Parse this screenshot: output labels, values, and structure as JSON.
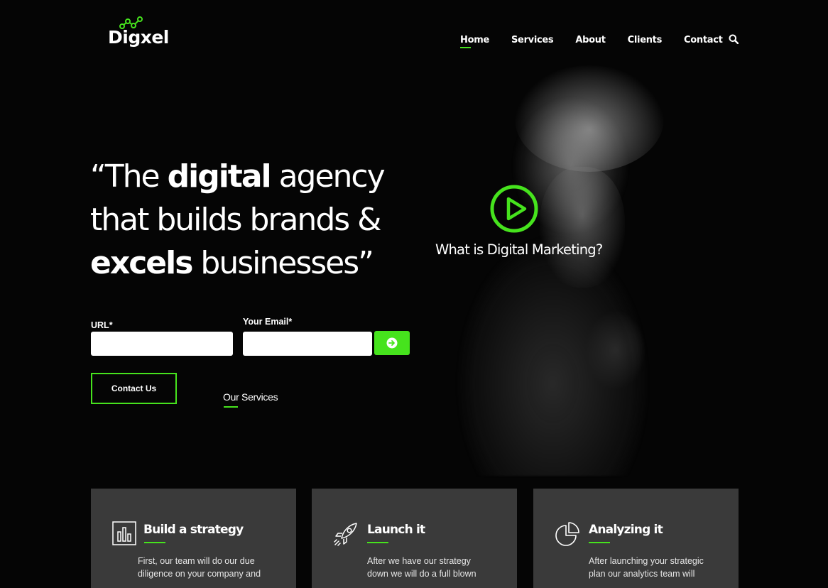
{
  "brand": {
    "name": "Digxel",
    "accent": "#46e31d"
  },
  "nav": {
    "items": [
      {
        "label": "Home",
        "active": true
      },
      {
        "label": "Services"
      },
      {
        "label": "About"
      },
      {
        "label": "Clients"
      },
      {
        "label": "Contact"
      }
    ],
    "search_icon": "search-icon"
  },
  "hero": {
    "line1_pre": "“The ",
    "line1_bold": "digital",
    "line1_post": " agency",
    "line2": "that builds brands &",
    "line3_bold": "excels",
    "line3_post": " businesses”"
  },
  "form": {
    "url_label": "URL*",
    "url_value": "",
    "email_label": "Your Email*",
    "email_value": "",
    "submit_icon": "arrow-right-circle-icon"
  },
  "cta": {
    "contact_label": "Contact Us",
    "services_label": "Our Services"
  },
  "video": {
    "caption": "What is Digital Marketing?",
    "icon": "play-circle-icon"
  },
  "cards": [
    {
      "icon": "bar-chart-icon",
      "title": "Build a strategy",
      "text_line1": "First, our team will do our due",
      "text_line2": "diligence on your company and"
    },
    {
      "icon": "rocket-icon",
      "title": "Launch it",
      "text_line1": "After we have our strategy",
      "text_line2": "down we will do a full blown"
    },
    {
      "icon": "pie-chart-icon",
      "title": "Analyzing it",
      "text_line1": "After launching your strategic",
      "text_line2": "plan our analytics team will"
    }
  ]
}
